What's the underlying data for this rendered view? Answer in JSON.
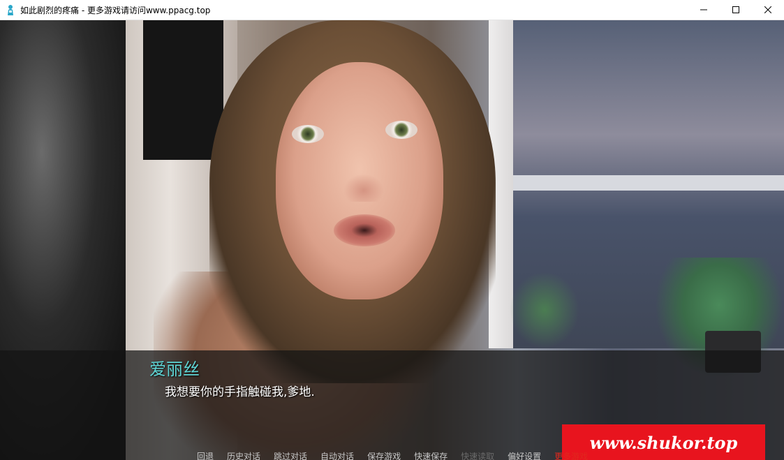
{
  "window": {
    "title": "如此剧烈的疼痛 - 更多游戏请访问www.ppacg.top",
    "icon": "renpy-app-icon",
    "controls": [
      "minimize-icon",
      "maximize-icon",
      "close-icon"
    ]
  },
  "dialogue": {
    "speaker": "爱丽丝",
    "text": "我想要你的手指触碰我,爹地.",
    "speaker_color": "#5fd6d6"
  },
  "watermark": {
    "text": "www.shukor.top",
    "background": "#e8141e"
  },
  "quick_menu": {
    "items": [
      {
        "label": "回退",
        "state": "normal"
      },
      {
        "label": "历史对话",
        "state": "normal"
      },
      {
        "label": "跳过对话",
        "state": "normal"
      },
      {
        "label": "自动对话",
        "state": "normal"
      },
      {
        "label": "保存游戏",
        "state": "normal"
      },
      {
        "label": "快速保存",
        "state": "normal"
      },
      {
        "label": "快速读取",
        "state": "disabled"
      },
      {
        "label": "偏好设置",
        "state": "normal"
      },
      {
        "label": "更多游戏",
        "state": "highlight"
      }
    ]
  }
}
